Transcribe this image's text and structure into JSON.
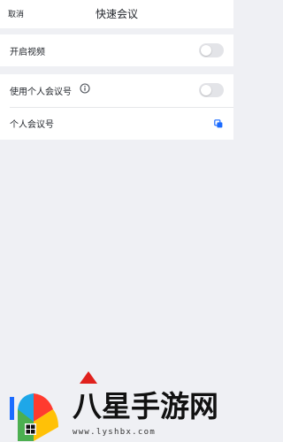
{
  "nav": {
    "cancel_label": "取消",
    "title": "快速会议"
  },
  "settings": {
    "video": {
      "label": "开启视频",
      "enabled": false
    },
    "pmi": {
      "label": "使用个人会议号",
      "enabled": false,
      "info_icon": "info-circle-icon"
    },
    "pmi_number": {
      "label": "个人会议号",
      "copy_icon": "copy-icon"
    }
  },
  "watermark": {
    "title": "八星手游网",
    "url": "www.lyshbx.com"
  },
  "colors": {
    "background": "#eff0f4",
    "card": "#ffffff",
    "toggle_off": "#e3e4e8",
    "accent": "#1b6bff",
    "watermark_arrow": "#e0211d"
  }
}
